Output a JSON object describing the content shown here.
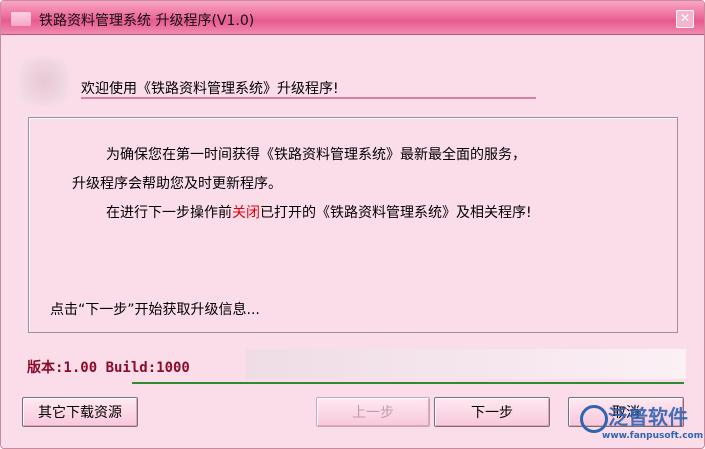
{
  "window": {
    "title": "铁路资料管理系统 升级程序(V1.0)",
    "close_glyph": "✕"
  },
  "header": {
    "welcome": "欢迎使用《铁路资料管理系统》升级程序!"
  },
  "content": {
    "line1": "为确保您在第一时间获得《铁路资料管理系统》最新最全面的服务，",
    "line2": "升级程序会帮助您及时更新程序。",
    "line3_before": "在进行下一步操作前",
    "line3_highlight": "关闭",
    "line3_after": "已打开的《铁路资料管理系统》及相关程序!",
    "hint": "点击“下一步”开始获取升级信息..."
  },
  "status": {
    "version_text": "版本:1.00 Build:1000",
    "progress": 0
  },
  "buttons": {
    "other_downloads": "其它下载资源",
    "prev": "上一步",
    "next": "下一步",
    "cancel": "取消"
  },
  "watermark": {
    "brand": "泛普软件",
    "url": "www.fanpusoft.com"
  },
  "colors": {
    "window_bg": "#fbdde9",
    "title_bar": "#e85a8f",
    "highlight_red": "#e0000a",
    "version_color": "#8a0c2a",
    "accent_green": "#2f8b2f"
  },
  "icons": {
    "title": "app-icon",
    "close": "close-icon",
    "logo": "app-logo",
    "watermark": "fanpu-logo-icon"
  }
}
